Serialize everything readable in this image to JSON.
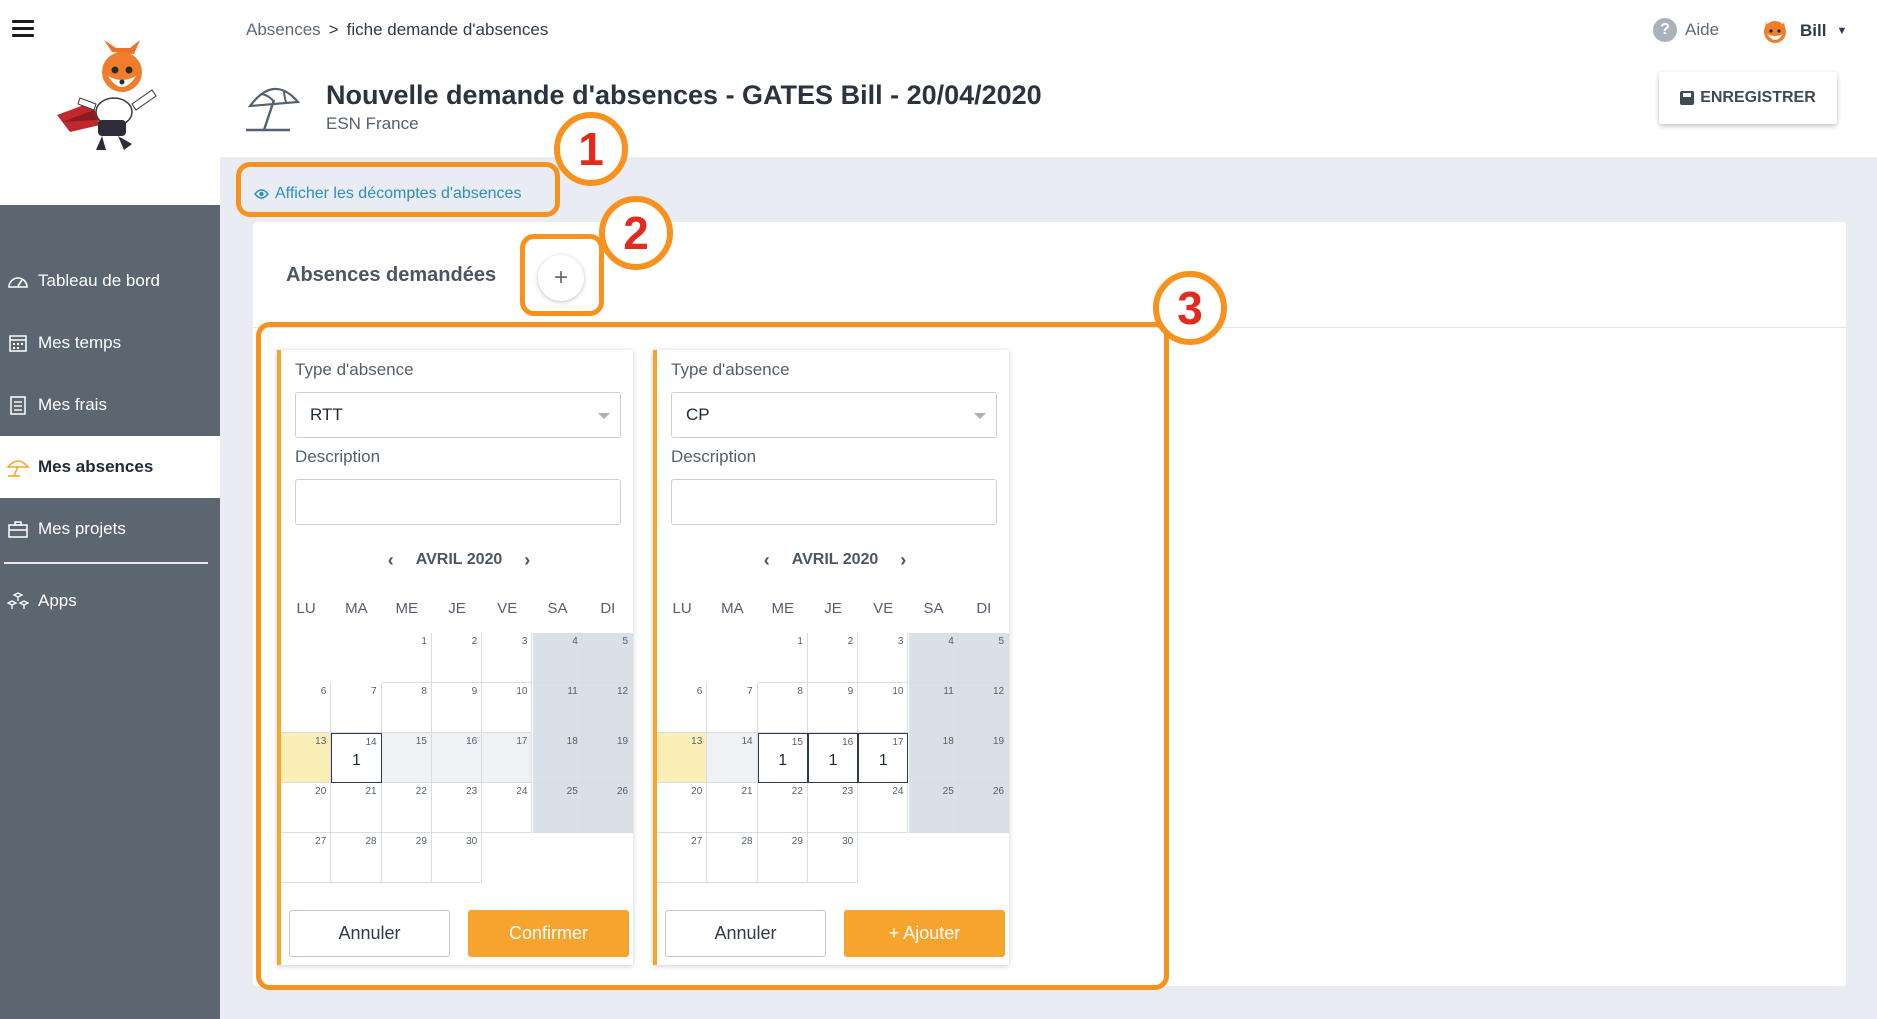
{
  "breadcrumb": {
    "root": "Absences",
    "separator": ">",
    "current": "fiche demande d'absences"
  },
  "header": {
    "title": "Nouvelle demande d'absences - GATES Bill - 20/04/2020",
    "subtitle": "ESN France",
    "save_label": "ENREGISTRER",
    "help_label": "Aide",
    "user_name": "Bill"
  },
  "sidebar": {
    "items": [
      {
        "label": "Tableau de bord",
        "icon": "dashboard-icon"
      },
      {
        "label": "Mes temps",
        "icon": "calendar-icon"
      },
      {
        "label": "Mes frais",
        "icon": "receipt-icon"
      },
      {
        "label": "Mes absences",
        "icon": "umbrella-icon",
        "active": true
      },
      {
        "label": "Mes projets",
        "icon": "briefcase-icon"
      },
      {
        "label": "Apps",
        "icon": "apps-icon"
      }
    ]
  },
  "toggle_link": "Afficher les décomptes d'absences",
  "section_title": "Absences demandées",
  "add_label": "+",
  "annotations": [
    "1",
    "2",
    "3"
  ],
  "calendar": {
    "month": "AVRIL 2020",
    "weekdays": [
      "LU",
      "MA",
      "ME",
      "JE",
      "VE",
      "SA",
      "DI"
    ]
  },
  "panels": [
    {
      "type_label": "Type d'absence",
      "type_value": "RTT",
      "desc_label": "Description",
      "desc_value": "",
      "cancel_label": "Annuler",
      "confirm_label": "Confirmer",
      "marked_days": {
        "14": "1"
      }
    },
    {
      "type_label": "Type d'absence",
      "type_value": "CP",
      "desc_label": "Description",
      "desc_value": "",
      "cancel_label": "Annuler",
      "confirm_label": "+ Ajouter",
      "marked_days": {
        "15": "1",
        "16": "1",
        "17": "1"
      }
    }
  ],
  "colors": {
    "accent": "#f7a42f",
    "annotation": "#f7921e",
    "badge_text": "#e42a1c",
    "sidebar": "#5c6670",
    "link": "#2a8fbd"
  }
}
